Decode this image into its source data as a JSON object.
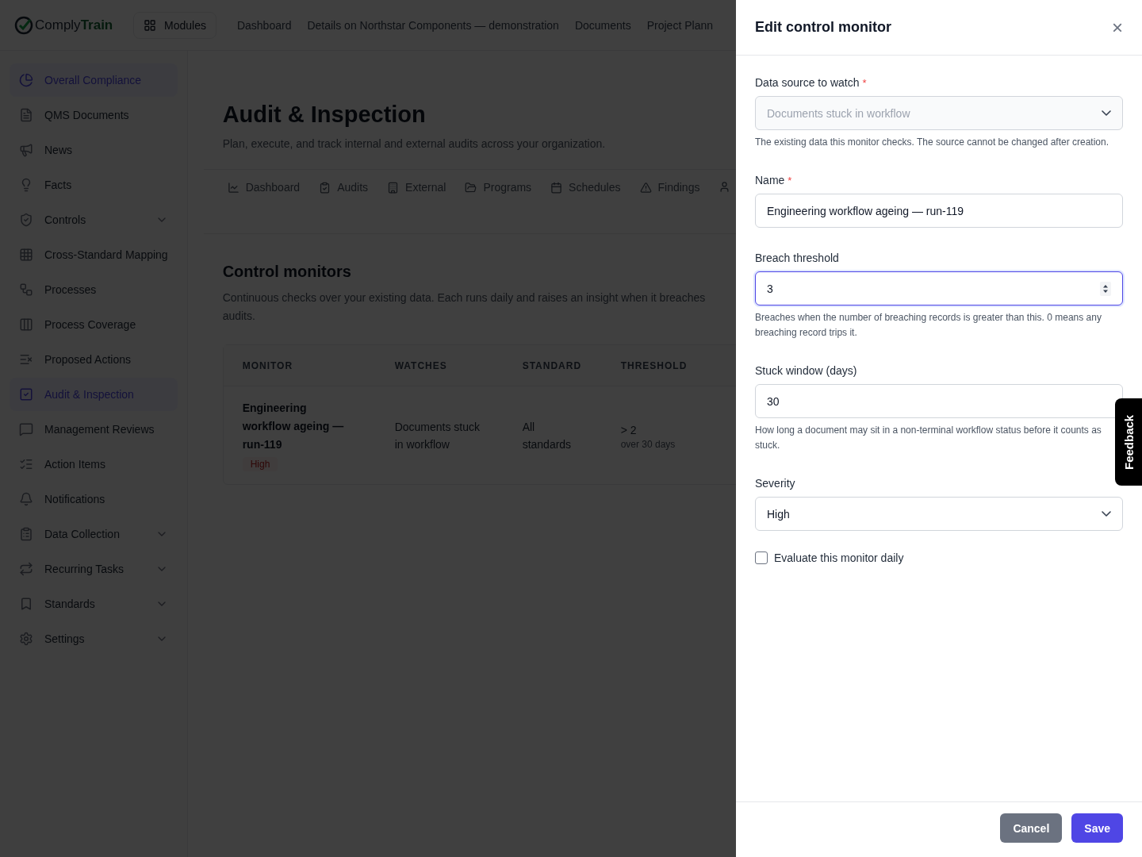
{
  "app": {
    "logo_first": "Comply",
    "logo_second": "Train",
    "modules_button": "Modules",
    "nav": [
      "Dashboard",
      "Details on Northstar Components — demonstration",
      "Documents",
      "Project Plann"
    ]
  },
  "sidebar": {
    "items": [
      {
        "label": "Overall Compliance",
        "selected": true,
        "expandable": false
      },
      {
        "label": "QMS Documents",
        "selected": false,
        "expandable": false
      },
      {
        "label": "News",
        "selected": false,
        "expandable": false
      },
      {
        "label": "Facts",
        "selected": false,
        "expandable": false
      },
      {
        "label": "Controls",
        "selected": false,
        "expandable": true
      },
      {
        "label": "Cross-Standard Mapping",
        "selected": false,
        "expandable": false
      },
      {
        "label": "Processes",
        "selected": false,
        "expandable": false
      },
      {
        "label": "Process Coverage",
        "selected": false,
        "expandable": false
      },
      {
        "label": "Proposed Actions",
        "selected": false,
        "expandable": false
      },
      {
        "label": "Audit & Inspection",
        "selected": true,
        "expandable": false
      },
      {
        "label": "Management Reviews",
        "selected": false,
        "expandable": false
      },
      {
        "label": "Action Items",
        "selected": false,
        "expandable": false
      },
      {
        "label": "Notifications",
        "selected": false,
        "expandable": false
      },
      {
        "label": "Data Collection",
        "selected": false,
        "expandable": true
      },
      {
        "label": "Recurring Tasks",
        "selected": false,
        "expandable": true
      },
      {
        "label": "Standards",
        "selected": false,
        "expandable": true
      },
      {
        "label": "Settings",
        "selected": false,
        "expandable": true
      }
    ]
  },
  "page": {
    "title": "Audit & Inspection",
    "subtitle": "Plan, execute, and track internal and external audits across your organization.",
    "tabs": [
      {
        "label": "Dashboard",
        "selected": false
      },
      {
        "label": "Audits",
        "selected": false
      },
      {
        "label": "External",
        "selected": false
      },
      {
        "label": "Programs",
        "selected": false
      },
      {
        "label": "Schedules",
        "selected": false
      },
      {
        "label": "Findings",
        "selected": false
      }
    ]
  },
  "monitors": {
    "title": "Control monitors",
    "description_lines": [
      "Continuous checks over your existing data. Each runs daily and raises an insight when it breaches",
      "audits."
    ],
    "columns": [
      "MONITOR",
      "WATCHES",
      "STANDARD",
      "THRESHOLD"
    ],
    "rows": [
      {
        "name": "Engineering workflow ageing — run-119",
        "severity": "High",
        "watches": "Documents stuck in workflow",
        "standard": "All standards",
        "threshold": "> 2",
        "threshold_detail": "over 30 days"
      }
    ]
  },
  "drawer": {
    "title": "Edit control monitor",
    "close": "×",
    "fields": [
      {
        "kind": "select",
        "label": "Data source to watch",
        "required_mark": "*",
        "value": "Documents stuck in workflow",
        "disabled": true,
        "focused": false,
        "help": "The existing data this monitor checks. The source cannot be changed after creation."
      },
      {
        "kind": "text",
        "label": "Name",
        "required_mark": "*",
        "value": "Engineering workflow ageing — run-119",
        "disabled": false,
        "focused": false
      },
      {
        "kind": "number",
        "label": "Breach threshold",
        "value": "3",
        "disabled": false,
        "focused": true,
        "help": "Breaches when the number of breaching records is greater than this. 0 means any breaching record trips it."
      },
      {
        "kind": "text",
        "label": "Stuck window (days)",
        "value": "30",
        "disabled": false,
        "focused": false,
        "help": "How long a document may sit in a non-terminal workflow status before it counts as stuck."
      },
      {
        "kind": "select",
        "label": "Severity",
        "value": "High",
        "disabled": false,
        "focused": false
      }
    ],
    "checkbox": {
      "label": "Evaluate this monitor daily",
      "checked": false
    },
    "buttons": [
      {
        "label": "Cancel",
        "kind": "secondary"
      },
      {
        "label": "Save",
        "kind": "primary"
      }
    ]
  },
  "feedback_tab": "Feedback"
}
